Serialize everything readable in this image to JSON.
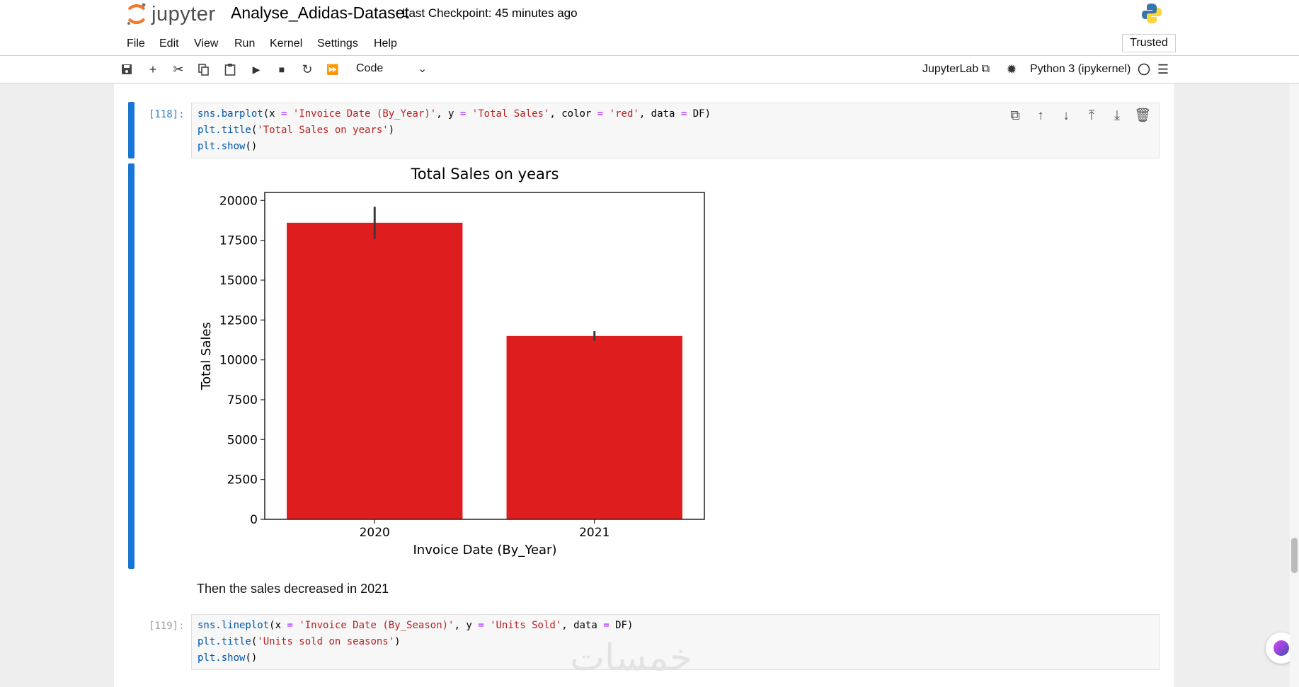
{
  "header": {
    "logo_text": "jupyter",
    "notebook_title": "Analyse_Adidas-Dataset",
    "checkpoint": "Last Checkpoint: 45 minutes ago"
  },
  "menu": {
    "items": [
      "File",
      "Edit",
      "View",
      "Run",
      "Kernel",
      "Settings",
      "Help"
    ],
    "trusted": "Trusted"
  },
  "toolbar": {
    "cell_type": "Code",
    "jupyterlab_label": "JupyterLab",
    "kernel_name": "Python 3 (ipykernel)",
    "icons": [
      "save-icon",
      "add-icon",
      "cut-icon",
      "copy-icon",
      "paste-icon",
      "run-icon",
      "stop-icon",
      "restart-icon",
      "fast-forward-icon"
    ]
  },
  "cells": [
    {
      "prompt": "[118]:",
      "lines": [
        "sns.barplot(x = 'Invoice Date (By_Year)', y = 'Total Sales', color = 'red', data = DF)",
        "plt.title('Total Sales on years')",
        "plt.show()"
      ]
    },
    {
      "markdown": "Then the sales decreased in 2021"
    },
    {
      "prompt": "[119]:",
      "lines": [
        "sns.lineplot(x = 'Invoice Date (By_Season)', y = 'Units Sold', data = DF)",
        "plt.title('Units sold on seasons')",
        "plt.show()"
      ]
    }
  ],
  "cell_tools": [
    "duplicate-icon",
    "move-up-icon",
    "move-down-icon",
    "insert-above-icon",
    "insert-below-icon",
    "delete-icon"
  ],
  "colors": {
    "bar": "#de1e1e",
    "accent": "#1976d2"
  },
  "watermark": "خمسات",
  "chart_data": {
    "type": "bar",
    "title": "Total Sales on years",
    "xlabel": "Invoice Date (By_Year)",
    "ylabel": "Total Sales",
    "categories": [
      "2020",
      "2021"
    ],
    "values": [
      18600,
      11500
    ],
    "error_low": [
      17600,
      11200
    ],
    "error_high": [
      19600,
      11800
    ],
    "ylim": [
      0,
      20500
    ],
    "yticks": [
      0,
      2500,
      5000,
      7500,
      10000,
      12500,
      15000,
      17500,
      20000
    ],
    "grid": false,
    "color": "#de1e1e"
  }
}
